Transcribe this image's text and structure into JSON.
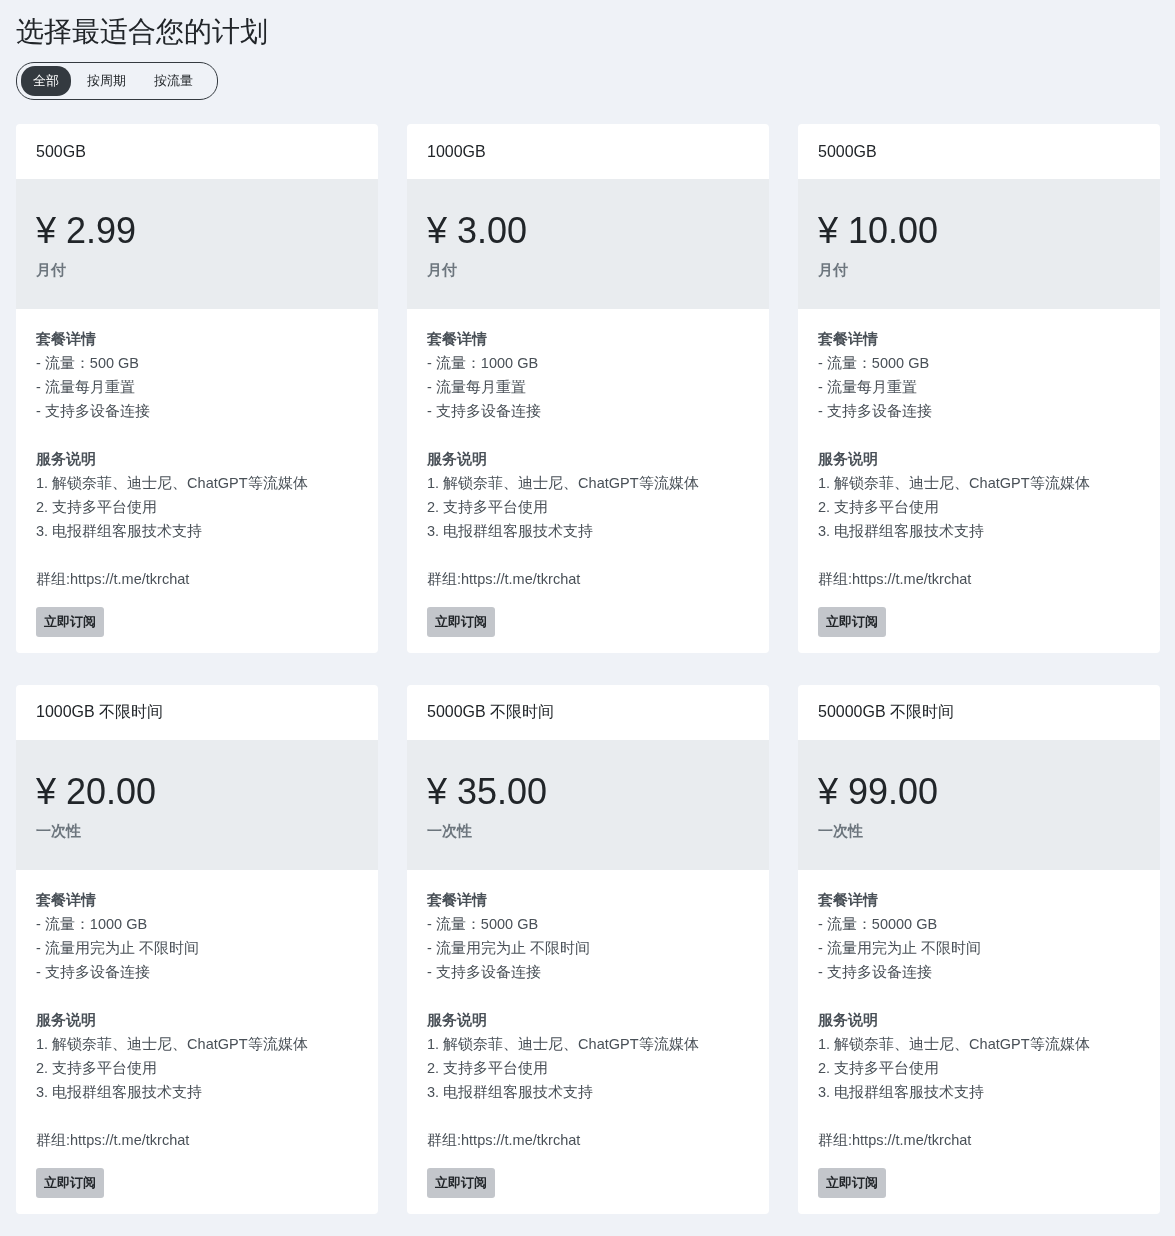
{
  "title": "选择最适合您的计划",
  "filters": [
    {
      "label": "全部",
      "selected": true
    },
    {
      "label": "按周期",
      "selected": false
    },
    {
      "label": "按流量",
      "selected": false
    }
  ],
  "plans": [
    {
      "name": "500GB",
      "price": "¥ 2.99",
      "period": "月付",
      "details_title": "套餐详情",
      "details": [
        "- 流量：500 GB",
        "- 流量每月重置",
        "- 支持多设备连接"
      ],
      "services_title": "服务说明",
      "services": [
        "1. 解锁奈菲、迪士尼、ChatGPT等流媒体",
        "2. 支持多平台使用",
        "3. 电报群组客服技术支持"
      ],
      "group": "群组:https://t.me/tkrchat",
      "button": "立即订阅"
    },
    {
      "name": "1000GB",
      "price": "¥ 3.00",
      "period": "月付",
      "details_title": "套餐详情",
      "details": [
        "- 流量：1000 GB",
        "- 流量每月重置",
        "- 支持多设备连接"
      ],
      "services_title": "服务说明",
      "services": [
        "1. 解锁奈菲、迪士尼、ChatGPT等流媒体",
        "2. 支持多平台使用",
        "3. 电报群组客服技术支持"
      ],
      "group": "群组:https://t.me/tkrchat",
      "button": "立即订阅"
    },
    {
      "name": "5000GB",
      "price": "¥ 10.00",
      "period": "月付",
      "details_title": "套餐详情",
      "details": [
        "- 流量：5000 GB",
        "- 流量每月重置",
        "- 支持多设备连接"
      ],
      "services_title": "服务说明",
      "services": [
        "1. 解锁奈菲、迪士尼、ChatGPT等流媒体",
        "2. 支持多平台使用",
        "3. 电报群组客服技术支持"
      ],
      "group": "群组:https://t.me/tkrchat",
      "button": "立即订阅"
    },
    {
      "name": "1000GB 不限时间",
      "price": "¥ 20.00",
      "period": "一次性",
      "details_title": "套餐详情",
      "details": [
        "- 流量：1000 GB",
        "- 流量用完为止 不限时间",
        "- 支持多设备连接"
      ],
      "services_title": "服务说明",
      "services": [
        "1. 解锁奈菲、迪士尼、ChatGPT等流媒体",
        "2. 支持多平台使用",
        "3. 电报群组客服技术支持"
      ],
      "group": "群组:https://t.me/tkrchat",
      "button": "立即订阅"
    },
    {
      "name": "5000GB 不限时间",
      "price": "¥ 35.00",
      "period": "一次性",
      "details_title": "套餐详情",
      "details": [
        "- 流量：5000 GB",
        "- 流量用完为止 不限时间",
        "- 支持多设备连接"
      ],
      "services_title": "服务说明",
      "services": [
        "1. 解锁奈菲、迪士尼、ChatGPT等流媒体",
        "2. 支持多平台使用",
        "3. 电报群组客服技术支持"
      ],
      "group": "群组:https://t.me/tkrchat",
      "button": "立即订阅"
    },
    {
      "name": "50000GB 不限时间",
      "price": "¥ 99.00",
      "period": "一次性",
      "details_title": "套餐详情",
      "details": [
        "- 流量：50000 GB",
        "- 流量用完为止 不限时间",
        "- 支持多设备连接"
      ],
      "services_title": "服务说明",
      "services": [
        "1. 解锁奈菲、迪士尼、ChatGPT等流媒体",
        "2. 支持多平台使用",
        "3. 电报群组客服技术支持"
      ],
      "group": "群组:https://t.me/tkrchat",
      "button": "立即订阅"
    }
  ]
}
